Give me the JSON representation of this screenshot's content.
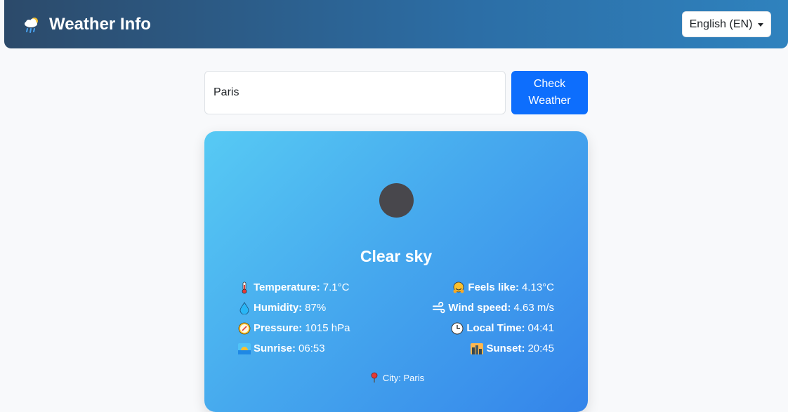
{
  "navbar": {
    "brand_icon": "cloud-rain-sun-icon",
    "brand_title": "Weather Info",
    "language_label": "English (EN)"
  },
  "search": {
    "value": "Paris",
    "button_label": "Check Weather"
  },
  "weather": {
    "icon": "weather-condition-icon",
    "condition": "Clear sky",
    "stats": [
      {
        "icon": "thermometer-icon",
        "label": "Temperature:",
        "value": "7.1°C"
      },
      {
        "icon": "hugging-face-icon",
        "label": "Feels like:",
        "value": "4.13°C"
      },
      {
        "icon": "droplet-icon",
        "label": "Humidity:",
        "value": "87%"
      },
      {
        "icon": "wind-icon",
        "label": "Wind speed:",
        "value": "4.63 m/s"
      },
      {
        "icon": "compass-icon",
        "label": "Pressure:",
        "value": "1015 hPa"
      },
      {
        "icon": "clock-icon",
        "label": "Local Time:",
        "value": "04:41"
      },
      {
        "icon": "sunrise-icon",
        "label": "Sunrise:",
        "value": "06:53"
      },
      {
        "icon": "sunset-city-icon",
        "label": "Sunset:",
        "value": "20:45"
      }
    ],
    "city_icon": "pin-icon",
    "city_text": "City: Paris"
  },
  "colors": {
    "navbar_gradient_start": "#2c4a6a",
    "navbar_gradient_end": "#2f82be",
    "primary_button": "#0d6efd",
    "card_gradient_start": "#57caf4",
    "card_gradient_end": "#3484ea",
    "weather_icon_fill": "#48474c"
  }
}
